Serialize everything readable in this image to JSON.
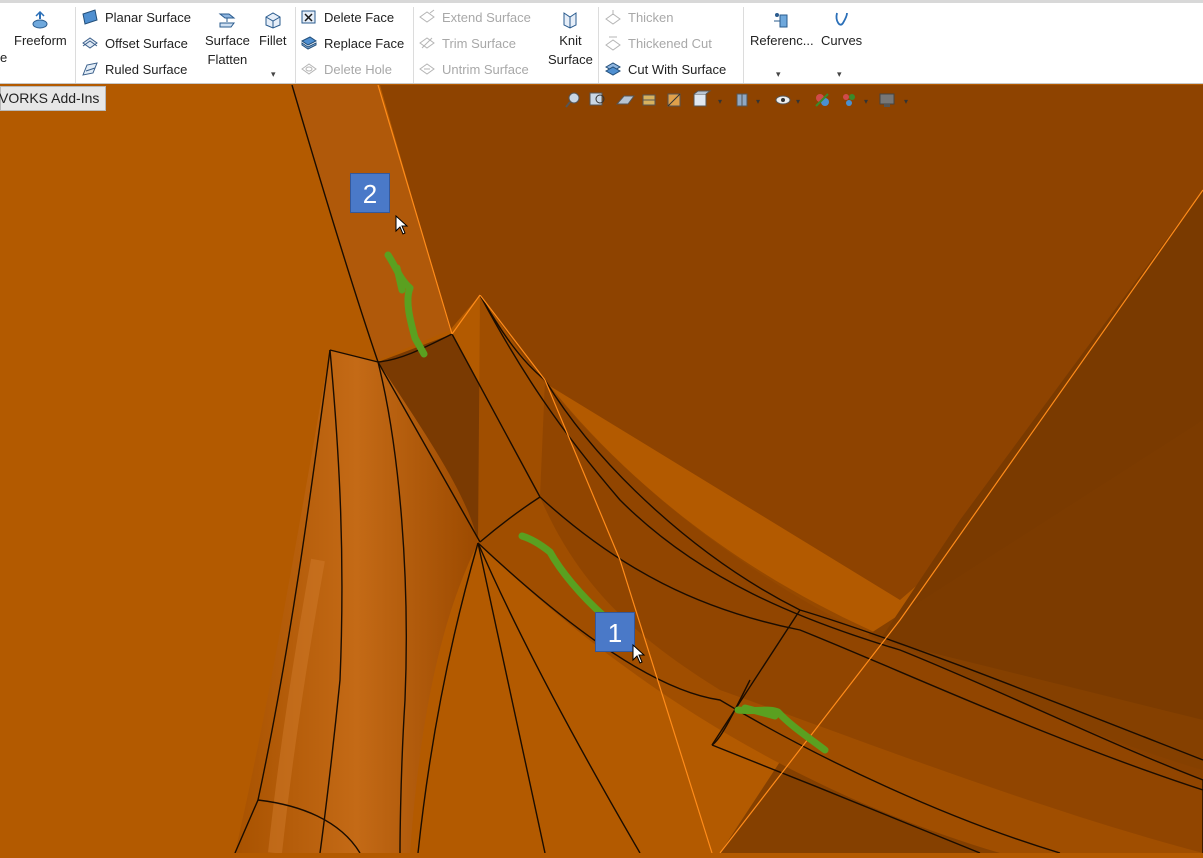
{
  "ribbon": {
    "partial_left": "e",
    "freeform": "Freeform",
    "planar_surface": "Planar Surface",
    "offset_surface": "Offset Surface",
    "ruled_surface": "Ruled Surface",
    "surface_flatten_line1": "Surface",
    "surface_flatten_line2": "Flatten",
    "fillet": "Fillet",
    "delete_face": "Delete Face",
    "replace_face": "Replace Face",
    "delete_hole": "Delete Hole",
    "extend_surface": "Extend Surface",
    "trim_surface": "Trim Surface",
    "untrim_surface": "Untrim Surface",
    "knit_surface_line1": "Knit",
    "knit_surface_line2": "Surface",
    "thicken": "Thicken",
    "thickened_cut": "Thickened Cut",
    "cut_with_surface": "Cut With Surface",
    "reference": "Referenc...",
    "curves": "Curves"
  },
  "tabs": {
    "addins": "VORKS Add-Ins"
  },
  "callouts": {
    "one": "1",
    "two": "2"
  },
  "colors": {
    "model_base": "#b35a00",
    "model_dark": "#7a3a02",
    "edge": "#1a0c00",
    "highlight_edge": "#ff8c1a",
    "green_mark": "#5aa020",
    "callout_bg": "#4a79c8"
  }
}
